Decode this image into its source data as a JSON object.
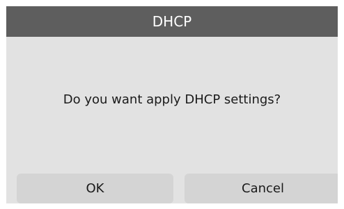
{
  "dialog": {
    "title": "DHCP",
    "message": "Do you want apply DHCP settings?",
    "ok_label": "OK",
    "cancel_label": "Cancel"
  },
  "colors": {
    "titlebar_bg": "#5e5e5e",
    "dialog_bg": "#e2e2e2",
    "button_bg": "#d4d4d4"
  }
}
